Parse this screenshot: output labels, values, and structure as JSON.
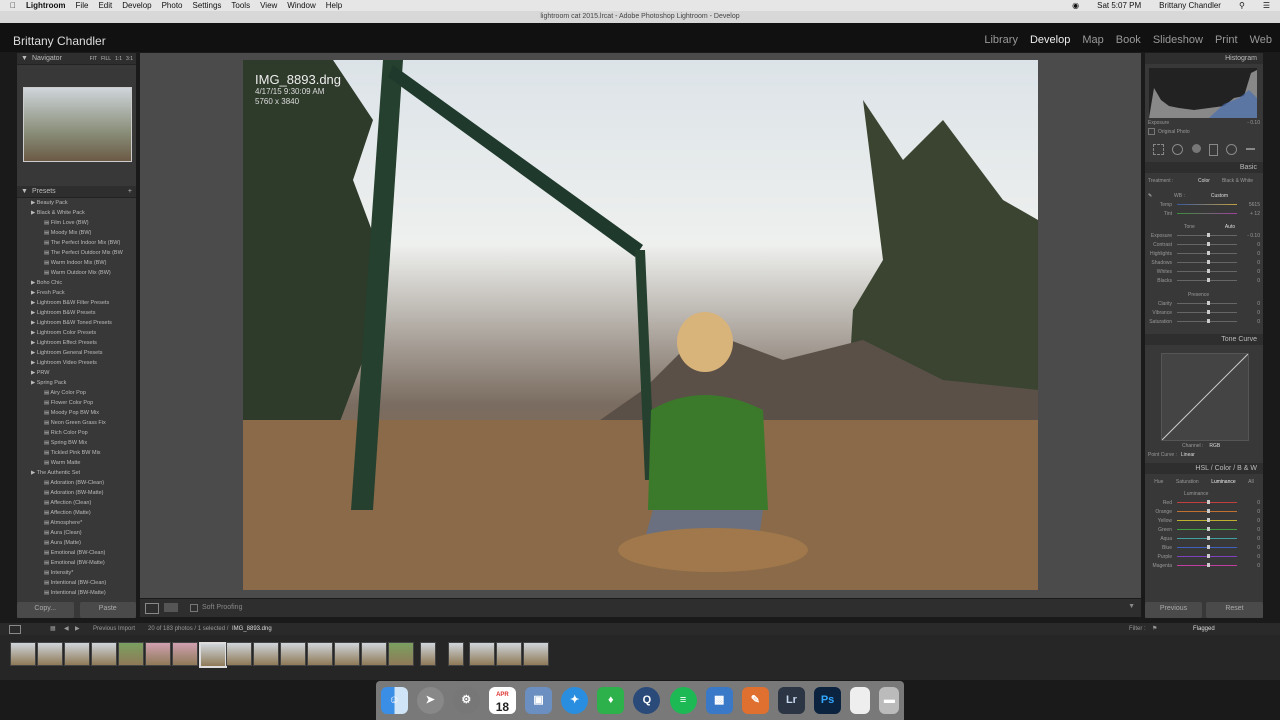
{
  "menubar": {
    "app": "Lightroom",
    "items": [
      "File",
      "Edit",
      "Develop",
      "Photo",
      "Settings",
      "Tools",
      "View",
      "Window",
      "Help"
    ],
    "time": "Sat 5:07 PM",
    "user": "Brittany Chandler"
  },
  "window_title": "lightroom cat 2015.lrcat - Adobe Photoshop Lightroom - Develop",
  "identity": "Brittany Chandler",
  "modules": [
    "Library",
    "Develop",
    "Map",
    "Book",
    "Slideshow",
    "Print",
    "Web"
  ],
  "active_module": "Develop",
  "navigator": {
    "title": "Navigator",
    "zoom_options": [
      "FIT",
      "FILL",
      "1:1",
      "3:1"
    ]
  },
  "presets": {
    "title": "Presets",
    "rows": [
      {
        "type": "folder",
        "label": "Beauty Pack"
      },
      {
        "type": "folder",
        "label": "Black & White Pack"
      },
      {
        "type": "item",
        "label": "Film Love (BW)"
      },
      {
        "type": "item",
        "label": "Moody Mix (BW)"
      },
      {
        "type": "item",
        "label": "The Perfect Indoor Mix (BW)"
      },
      {
        "type": "item",
        "label": "The Perfect Outdoor Mix (BW"
      },
      {
        "type": "item",
        "label": "Warm Indoor Mix (BW)"
      },
      {
        "type": "item",
        "label": "Warm Outdoor Mix (BW)"
      },
      {
        "type": "folder",
        "label": "Boho Chic"
      },
      {
        "type": "folder",
        "label": "Fresh Pack"
      },
      {
        "type": "folder",
        "label": "Lightroom B&W Filter Presets"
      },
      {
        "type": "folder",
        "label": "Lightroom B&W Presets"
      },
      {
        "type": "folder",
        "label": "Lightroom B&W Toned Presets"
      },
      {
        "type": "folder",
        "label": "Lightroom Color Presets"
      },
      {
        "type": "folder",
        "label": "Lightroom Effect Presets"
      },
      {
        "type": "folder",
        "label": "Lightroom General Presets"
      },
      {
        "type": "folder",
        "label": "Lightroom Video Presets"
      },
      {
        "type": "folder",
        "label": "PRW"
      },
      {
        "type": "folder",
        "label": "Spring Pack"
      },
      {
        "type": "item",
        "label": "Airy Color Pop"
      },
      {
        "type": "item",
        "label": "Flower Color Pop"
      },
      {
        "type": "item",
        "label": "Moody Pop BW Mix"
      },
      {
        "type": "item",
        "label": "Neon Green Grass Fix"
      },
      {
        "type": "item",
        "label": "Rich Color Pop"
      },
      {
        "type": "item",
        "label": "Spring BW Mix"
      },
      {
        "type": "item",
        "label": "Tickled Pink BW Mix"
      },
      {
        "type": "item",
        "label": "Warm Matte"
      },
      {
        "type": "folder",
        "label": "The Authentic Set"
      },
      {
        "type": "item",
        "label": "Adoration (BW-Clean)"
      },
      {
        "type": "item",
        "label": "Adoration (BW-Matte)"
      },
      {
        "type": "item",
        "label": "Affection (Clean)"
      },
      {
        "type": "item",
        "label": "Affection (Matte)"
      },
      {
        "type": "item",
        "label": "Atmosphere*"
      },
      {
        "type": "item",
        "label": "Aura (Clean)"
      },
      {
        "type": "item",
        "label": "Aura (Matte)"
      },
      {
        "type": "item",
        "label": "Emotional (BW-Clean)"
      },
      {
        "type": "item",
        "label": "Emotional (BW-Matte)"
      },
      {
        "type": "item",
        "label": "Intensity*"
      },
      {
        "type": "item",
        "label": "Intentional (BW-Clean)"
      },
      {
        "type": "item",
        "label": "Intentional (BW-Matte)"
      }
    ]
  },
  "left_buttons": {
    "copy": "Copy...",
    "paste": "Paste"
  },
  "photo_info": {
    "filename": "IMG_8893.dng",
    "date": "4/17/15 9:30:09 AM",
    "dimensions": "5760 x 3840"
  },
  "toolbar": {
    "soft_proofing": "Soft Proofing"
  },
  "right_panel": {
    "histogram_title": "Histogram",
    "exposure_readout": "Exposure",
    "exposure_readout_value": "- 0.10",
    "original_photo": "Original Photo",
    "basic_title": "Basic",
    "treatment_label": "Treatment :",
    "treatment_color": "Color",
    "treatment_bw": "Black & White",
    "wb_label": "WB :",
    "wb_value": "Custom",
    "temp": {
      "label": "Temp",
      "value": "5615"
    },
    "tint": {
      "label": "Tint",
      "value": "+ 12"
    },
    "tone_label": "Tone",
    "auto_label": "Auto",
    "tone_sliders": [
      {
        "label": "Exposure",
        "value": "- 0.10"
      },
      {
        "label": "Contrast",
        "value": "0"
      },
      {
        "label": "Highlights",
        "value": "0"
      },
      {
        "label": "Shadows",
        "value": "0"
      },
      {
        "label": "Whites",
        "value": "0"
      },
      {
        "label": "Blacks",
        "value": "0"
      }
    ],
    "presence_label": "Presence",
    "presence_sliders": [
      {
        "label": "Clarity",
        "value": "0"
      },
      {
        "label": "Vibrance",
        "value": "0"
      },
      {
        "label": "Saturation",
        "value": "0"
      }
    ],
    "tone_curve_title": "Tone Curve",
    "channel_label": "Channel :",
    "channel_value": "RGB",
    "point_curve_label": "Point Curve :",
    "point_curve_value": "Linear",
    "hsl_title": "HSL  /  Color  /  B & W",
    "hsl_tabs": [
      "Hue",
      "Saturation",
      "Luminance",
      "All"
    ],
    "hsl_active": "Luminance",
    "luminance_label": "Luminance",
    "luminance_sliders": [
      {
        "label": "Red",
        "value": "0"
      },
      {
        "label": "Orange",
        "value": "0"
      },
      {
        "label": "Yellow",
        "value": "0"
      },
      {
        "label": "Green",
        "value": "0"
      },
      {
        "label": "Aqua",
        "value": "0"
      },
      {
        "label": "Blue",
        "value": "0"
      },
      {
        "label": "Purple",
        "value": "0"
      },
      {
        "label": "Magenta",
        "value": "0"
      }
    ],
    "previous": "Previous",
    "reset": "Reset"
  },
  "filmstrip_bar": {
    "source": "Previous Import",
    "count": "20 of 183 photos / 1 selected /",
    "selected_file": "IMG_8893.dng",
    "filter_label": "Filter :",
    "filter_value": "Flagged"
  },
  "dock": {
    "calendar_month": "APR",
    "calendar_day": "18",
    "lr": "Lr",
    "ps": "Ps"
  }
}
